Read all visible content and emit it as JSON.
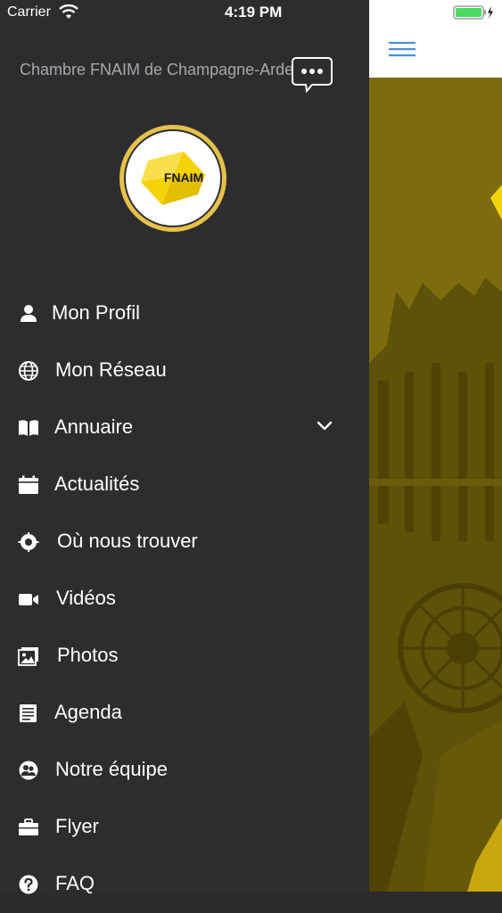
{
  "status_bar": {
    "carrier": "Carrier",
    "time": "4:19 PM",
    "wifi_icon": "wifi-icon",
    "battery_icon": "battery-charging-icon"
  },
  "drawer": {
    "title": "Chambre FNAIM de Champagne-Ardenne",
    "chat_icon": "chat-bubble-icon",
    "logo_text": "FNAIM",
    "menu": [
      {
        "label": "Mon Profil",
        "icon": "user-icon"
      },
      {
        "label": "Mon Réseau",
        "icon": "globe-icon"
      },
      {
        "label": "Annuaire",
        "icon": "book-icon",
        "expandable": true
      },
      {
        "label": "Actualités",
        "icon": "calendar-icon"
      },
      {
        "label": "Où nous trouver",
        "icon": "location-icon"
      },
      {
        "label": "Vidéos",
        "icon": "video-camera-icon"
      },
      {
        "label": "Photos",
        "icon": "photos-icon"
      },
      {
        "label": "Agenda",
        "icon": "notepad-icon"
      },
      {
        "label": "Notre équipe",
        "icon": "team-icon"
      },
      {
        "label": "Flyer",
        "icon": "briefcase-icon"
      },
      {
        "label": "FAQ",
        "icon": "question-icon"
      }
    ]
  },
  "content": {
    "menu_icon": "hamburger-menu-icon",
    "colors": {
      "accent_blue": "#4a90d9",
      "brand_yellow": "#f5d20a",
      "photo_tint": "#7a6a0c",
      "drawer_bg": "#2d2d2f"
    }
  }
}
